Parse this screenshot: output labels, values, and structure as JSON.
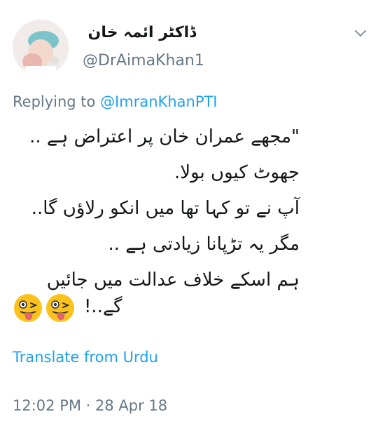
{
  "tweet": {
    "display_name": "ڈاکٹر ائمہ خان",
    "handle": "@DrAimaKhan1",
    "replying_prefix": "Replying to",
    "replying_to": "@ImranKhanPTI",
    "lines": [
      "\"مجھے عمران خان پر اعتراض ہے ..",
      "جھوٹ کیوں بولا.",
      "آپ نے تو کہا تھا میں انکو رلاؤں گا..",
      "مگر یہ تڑپانا زیادتی ہے ..",
      "ہم اسکے خلاف عدالت میں جائیں"
    ],
    "last_line": "گے..!",
    "emojis": [
      "winking-face-with-tongue",
      "winking-face-with-tongue"
    ],
    "translate_label": "Translate from Urdu",
    "timestamp": "12:02 PM · 28 Apr 18"
  },
  "colors": {
    "link": "#1da1f2",
    "secondary": "#657786",
    "text": "#14171a"
  }
}
